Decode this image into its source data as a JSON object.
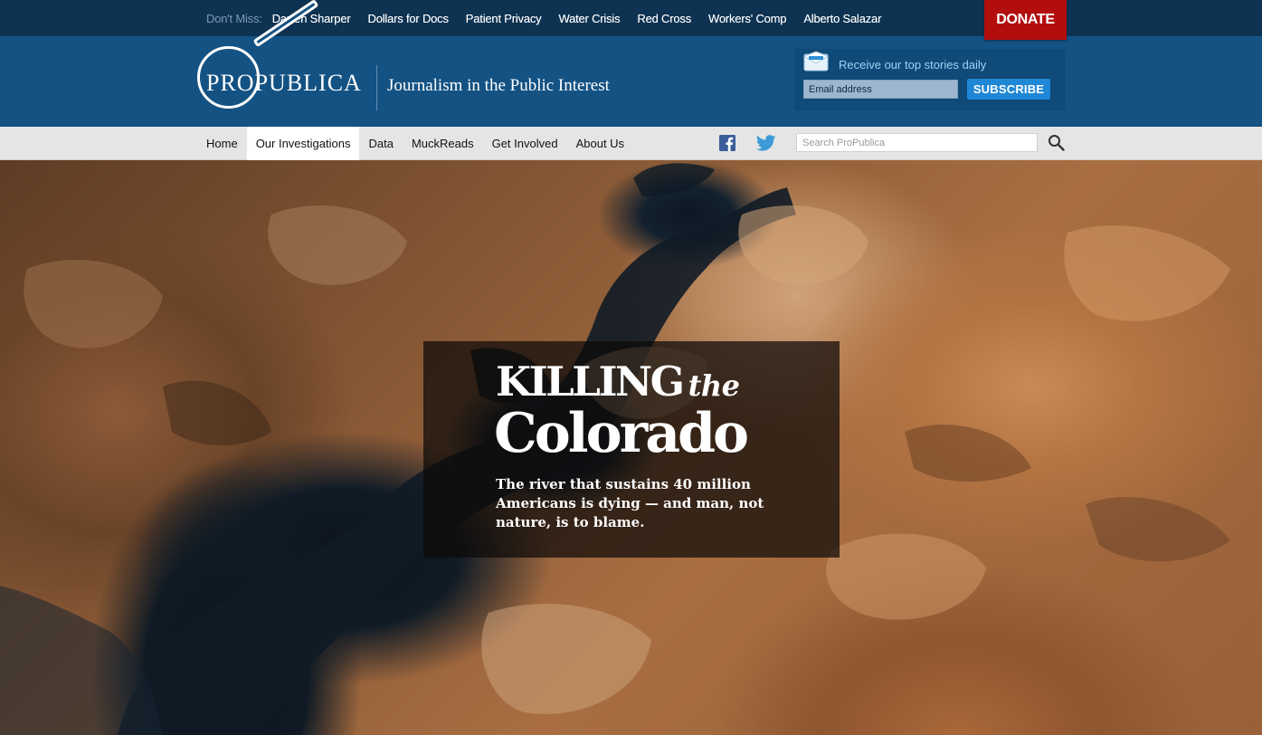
{
  "top_bar": {
    "dont_miss_label": "Don't Miss:",
    "links": [
      "Darren Sharper",
      "Dollars for Docs",
      "Patient Privacy",
      "Water Crisis",
      "Red Cross",
      "Workers' Comp",
      "Alberto Salazar"
    ],
    "donate_label": "DONATE",
    "colors": {
      "background": "#0e3352",
      "donate": "#b20e0e"
    }
  },
  "header": {
    "logo": {
      "pro": "Pro",
      "publica": "Publica"
    },
    "tagline": "Journalism in the Public Interest",
    "newsletter": {
      "icon": "envelope-icon",
      "text": "Receive our top stories daily",
      "email_placeholder": "Email address",
      "subscribe_label": "SUBSCRIBE"
    },
    "colors": {
      "background": "#145283",
      "subscribe": "#1f87d6"
    }
  },
  "nav": {
    "items": [
      "Home",
      "Our Investigations",
      "Data",
      "MuckReads",
      "Get Involved",
      "About Us"
    ],
    "active": "Our Investigations",
    "social": [
      "facebook-icon",
      "twitter-icon"
    ],
    "search_placeholder": "Search ProPublica"
  },
  "hero": {
    "title_line1": "KILLING",
    "title_the": "the",
    "title_line2": "Colorado",
    "subtitle": "The river that sustains 40 million Americans is dying — and man, not nature, is to blame."
  }
}
